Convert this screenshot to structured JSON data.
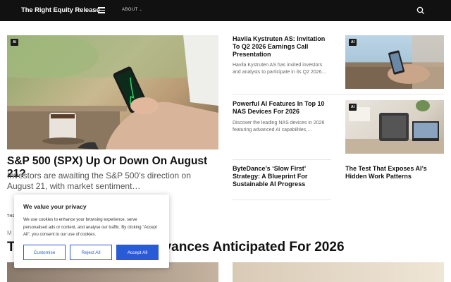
{
  "header": {
    "brand": "The Right Equity Release",
    "nav_about": "ABOUT"
  },
  "hero": {
    "tag": "AI",
    "title": "S&P 500 (SPX) Up Or Down On August 21?",
    "description": "Investors are awaiting the S&P 500's direction on August 21, with market sentiment…"
  },
  "cards": [
    {
      "title": "Havila Kystruten AS: Invitation To Q2 2026 Earnings Call Presentation",
      "description": "Havila Kystruten AS has invited investors and analysts to participate in its Q2 2026…",
      "tag": "AI"
    },
    {
      "title": "Powerful AI Features In Top 10 NAS Devices For 2026",
      "description": "Discover the leading NAS devices in 2026 featuring advanced AI capabilities,…",
      "tag": "AI"
    },
    {
      "title": "ByteDance’s ‘Slow First’ Strategy: A Blueprint For Sustainable AI Progress"
    },
    {
      "title": "The Test That Exposes AI’s Hidden Work Patterns"
    }
  ],
  "section": {
    "label": "THE",
    "small": "M",
    "title_start": "T",
    "title_end": "vances Anticipated For 2026"
  },
  "cookie": {
    "title": "We value your privacy",
    "text": "We use cookies to enhance your browsing experience, serve personalised ads or content, and analyse our traffic. By clicking \"Accept All\", you consent to our use of cookies.",
    "customise": "Customise",
    "reject": "Reject All",
    "accept": "Accept All"
  }
}
